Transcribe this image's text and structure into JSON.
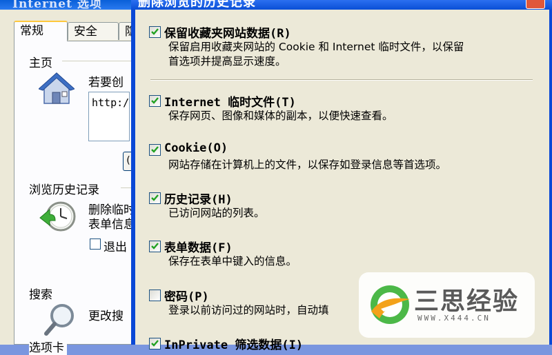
{
  "back_window": {
    "title": "Internet 选项",
    "tabs": [
      "常规",
      "安全",
      "隐"
    ],
    "home": {
      "label": "主页",
      "text": "若要创",
      "url": "http:/"
    },
    "button_stub": "(",
    "history": {
      "label": "浏览历史记录",
      "line1": "删除临时",
      "line2": "表单信息",
      "checkbox_label": "退出"
    },
    "search": {
      "label": "搜索",
      "text": "更改搜"
    },
    "tabs_group": {
      "label": "选项卡"
    }
  },
  "dialog": {
    "title": "删除浏览的历史记录",
    "items": [
      {
        "checked": true,
        "title": "保留收藏夹网站数据(R)",
        "desc": [
          "保留启用收藏夹网站的 Cookie 和 Internet 临时文件，以保留",
          "首选项并提高显示速度。"
        ]
      },
      {
        "checked": true,
        "title": "Internet 临时文件(T)",
        "desc": [
          "保存网页、图像和媒体的副本，以便快速查看。"
        ]
      },
      {
        "checked": true,
        "title": "Cookie(O)",
        "desc": [
          "网站存储在计算机上的文件，以保存如登录信息等首选项。"
        ]
      },
      {
        "checked": true,
        "title": "历史记录(H)",
        "desc": [
          "已访问网站的列表。"
        ]
      },
      {
        "checked": true,
        "title": "表单数据(F)",
        "desc": [
          "保存在表单中键入的信息。"
        ]
      },
      {
        "checked": false,
        "title": "密码(P)",
        "desc": [
          "登录以前访问过的网站时，自动填"
        ]
      },
      {
        "checked": true,
        "title": "InPrivate 筛选数据(I)",
        "desc": []
      }
    ]
  },
  "watermark": {
    "brand": "三思经验",
    "url": "WWW.X444.CN"
  }
}
